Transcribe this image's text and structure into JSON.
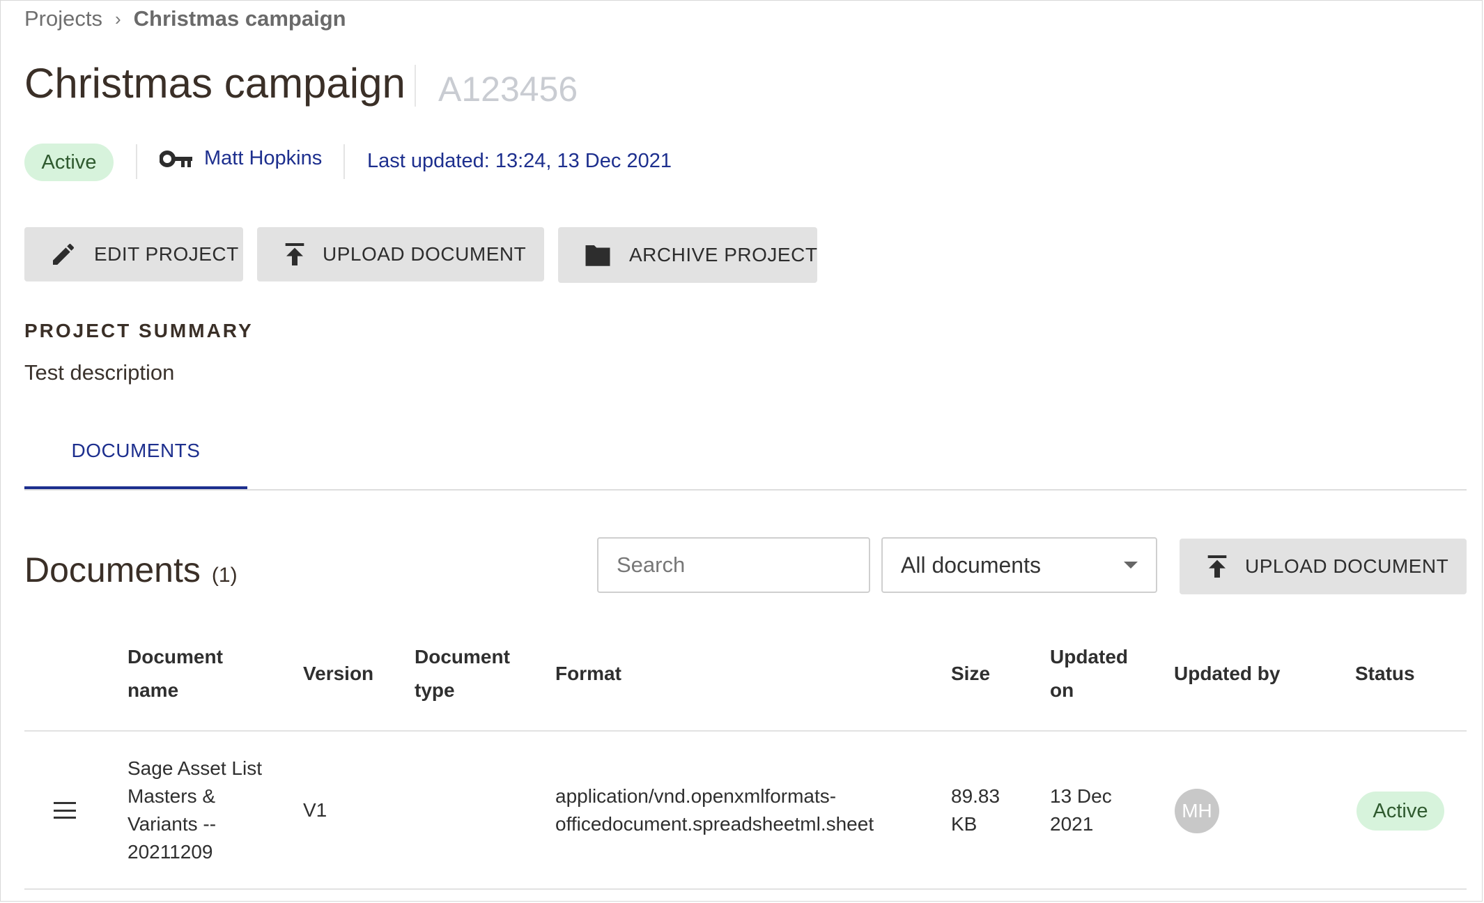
{
  "breadcrumb": {
    "root": "Projects",
    "separator": "›",
    "current": "Christmas campaign"
  },
  "project": {
    "title": "Christmas campaign",
    "code": "A123456",
    "status": "Active",
    "owner": "Matt Hopkins",
    "last_updated": "Last updated: 13:24, 13 Dec 2021"
  },
  "actions": {
    "edit": "EDIT PROJECT",
    "upload": "UPLOAD DOCUMENT",
    "archive": "ARCHIVE PROJECT"
  },
  "summary": {
    "heading": "PROJECT SUMMARY",
    "text": "Test description"
  },
  "tabs": [
    {
      "label": "DOCUMENTS",
      "active": true
    }
  ],
  "documents": {
    "title": "Documents",
    "count": "(1)",
    "search_placeholder": "Search",
    "filter_value": "All documents",
    "upload_label": "UPLOAD DOCUMENT",
    "columns": {
      "name_line1": "Document",
      "name_line2": "name",
      "version": "Version",
      "type_line1": "Document",
      "type_line2": "type",
      "format": "Format",
      "size": "Size",
      "updated_on_line1": "Updated",
      "updated_on_line2": "on",
      "updated_by": "Updated by",
      "status": "Status"
    },
    "rows": [
      {
        "name_lines": [
          "Sage Asset List",
          "Masters &",
          "Variants --",
          "20211209"
        ],
        "version": "V1",
        "type": "",
        "format_lines": [
          "application/vnd.openxmlformats-",
          "officedocument.spreadsheetml.sheet"
        ],
        "size_lines": [
          "89.83",
          "KB"
        ],
        "updated_on_lines": [
          "13 Dec",
          "2021"
        ],
        "updated_by_initials": "MH",
        "status": "Active"
      }
    ]
  },
  "colors": {
    "accent": "#1d2f8e",
    "status_bg": "#d7f3dc",
    "button_bg": "#e2e2e2"
  },
  "icons": [
    "key-icon",
    "pencil-icon",
    "upload-icon",
    "folder-icon",
    "chevron-down-icon",
    "drag-handle-icon"
  ]
}
